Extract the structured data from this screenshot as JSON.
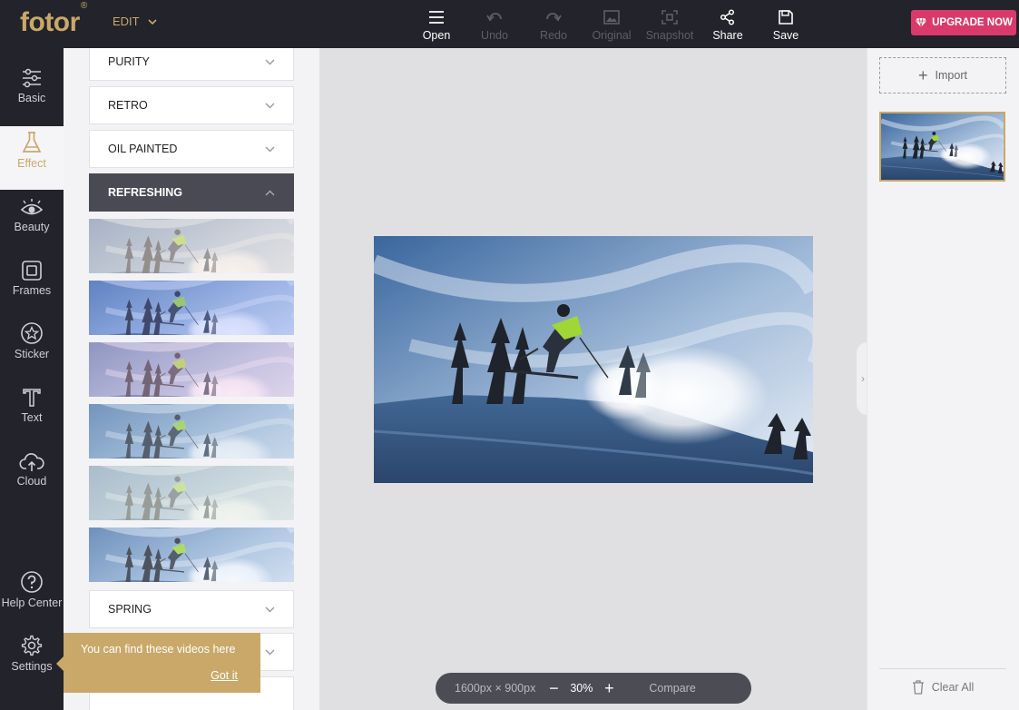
{
  "app": {
    "logo": "fotor",
    "logo_mark": "®",
    "edit_menu": "EDIT"
  },
  "toolbar": {
    "open": "Open",
    "undo": "Undo",
    "redo": "Redo",
    "original": "Original",
    "snapshot": "Snapshot",
    "share": "Share",
    "save": "Save",
    "upgrade": "UPGRADE NOW"
  },
  "leftnav": {
    "items": [
      {
        "label": "Basic",
        "icon": "sliders-icon"
      },
      {
        "label": "Effect",
        "icon": "flask-icon"
      },
      {
        "label": "Beauty",
        "icon": "eye-icon"
      },
      {
        "label": "Frames",
        "icon": "frame-icon"
      },
      {
        "label": "Sticker",
        "icon": "star-icon"
      },
      {
        "label": "Text",
        "icon": "text-icon"
      },
      {
        "label": "Cloud",
        "icon": "cloud-icon"
      },
      {
        "label": "Help Center",
        "icon": "help-icon"
      },
      {
        "label": "Settings",
        "icon": "gear-icon"
      }
    ],
    "active": "Effect"
  },
  "effects": {
    "categories": {
      "purity": "PURITY",
      "retro": "RETRO",
      "oil_painted": "OIL PAINTED",
      "refreshing": "REFRESHING",
      "spring": "SPRING"
    },
    "expanded": "REFRESHING"
  },
  "canvas": {
    "dimensions": "1600px × 900px",
    "zoom": "30%",
    "zoom_out": "−",
    "zoom_in": "+",
    "compare": "Compare"
  },
  "rightpanel": {
    "import": "Import",
    "clear_all": "Clear All"
  },
  "tooltip": {
    "message": "You can find these videos here",
    "action": "Got it"
  },
  "colors": {
    "brand_gold": "#c9a869",
    "upgrade_pink": "#d93a6b",
    "dark_bg": "#23232b"
  }
}
